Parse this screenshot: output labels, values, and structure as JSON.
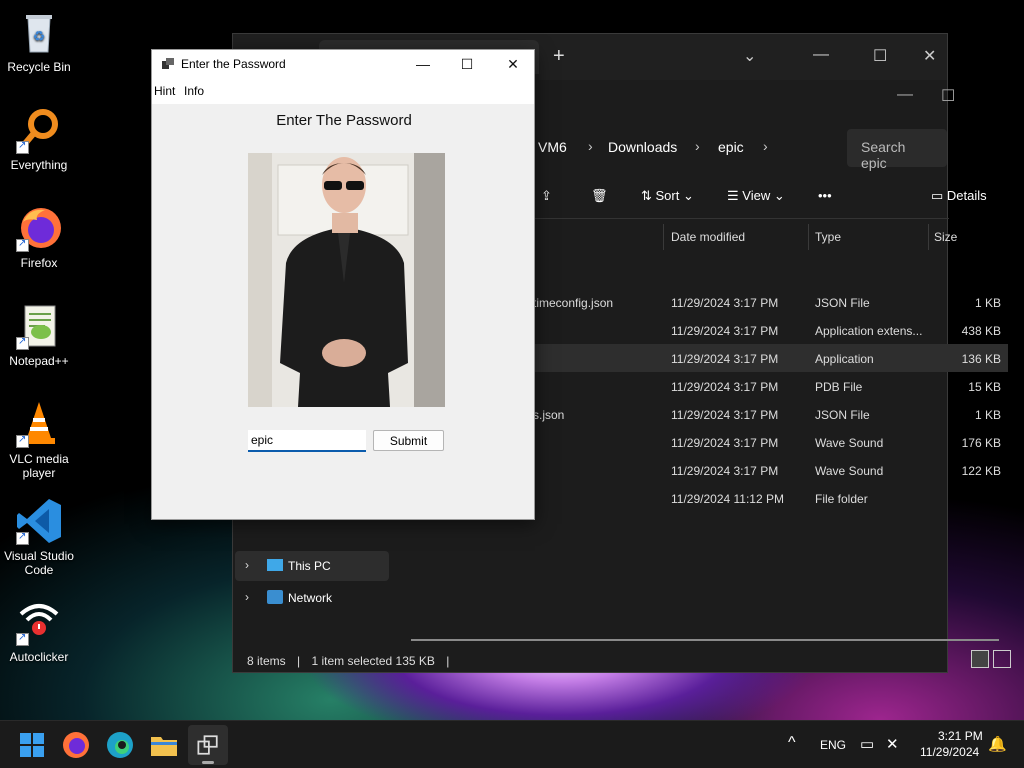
{
  "desktop_icons": [
    {
      "label": "Recycle Bin"
    },
    {
      "label": "Everything"
    },
    {
      "label": "Firefox"
    },
    {
      "label": "Notepad++"
    },
    {
      "label": "VLC media player"
    },
    {
      "label": "Visual Studio Code"
    },
    {
      "label": "Autoclicker"
    }
  ],
  "explorer": {
    "breadcrumb": [
      "VM6",
      "Downloads",
      "epic"
    ],
    "search_placeholder": "Search epic",
    "toolbar": {
      "sort": "Sort",
      "view": "View",
      "more": "•••",
      "details": "Details"
    },
    "columns": {
      "date": "Date modified",
      "type": "Type",
      "size": "Size"
    },
    "rows": [
      {
        "name": "timeconfig.json",
        "date": "11/29/2024 3:17 PM",
        "type": "JSON File",
        "size": "1 KB"
      },
      {
        "name": "",
        "date": "11/29/2024 3:17 PM",
        "type": "Application extens...",
        "size": "438 KB"
      },
      {
        "name": "",
        "date": "11/29/2024 3:17 PM",
        "type": "Application",
        "size": "136 KB"
      },
      {
        "name": "",
        "date": "11/29/2024 3:17 PM",
        "type": "PDB File",
        "size": "15 KB"
      },
      {
        "name": "s.json",
        "date": "11/29/2024 3:17 PM",
        "type": "JSON File",
        "size": "1 KB"
      },
      {
        "name": "",
        "date": "11/29/2024 3:17 PM",
        "type": "Wave Sound",
        "size": "176 KB"
      },
      {
        "name": "",
        "date": "11/29/2024 3:17 PM",
        "type": "Wave Sound",
        "size": "122 KB"
      },
      {
        "name": "",
        "date": "11/29/2024 11:12 PM",
        "type": "File folder",
        "size": ""
      }
    ],
    "nav": {
      "this_pc": "This PC",
      "network": "Network"
    },
    "status": {
      "items": "8 items",
      "selected": "1 item selected  135 KB"
    }
  },
  "dialog": {
    "title": "Enter the Password",
    "menu": {
      "hint": "Hint",
      "info": "Info"
    },
    "heading": "Enter The Password",
    "input_value": "epic",
    "submit_label": "Submit"
  },
  "taskbar": {
    "lang": "ENG",
    "time": "3:21 PM",
    "date": "11/29/2024"
  }
}
